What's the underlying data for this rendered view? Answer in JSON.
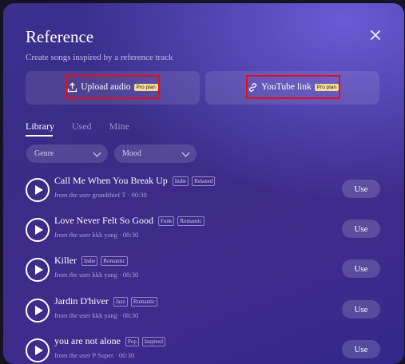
{
  "dialog": {
    "title": "Reference",
    "subtitle": "Create songs inspired by a reference track"
  },
  "sources": {
    "upload": {
      "label": "Upload audio",
      "badge": "Pro plan",
      "icon": "upload-icon"
    },
    "youtube": {
      "label": "YouTube link",
      "badge": "Pro plan",
      "icon": "link-icon"
    }
  },
  "tabs": [
    "Library",
    "Used",
    "Mine"
  ],
  "filters": {
    "genre": "Genre",
    "mood": "Mood"
  },
  "songs": [
    {
      "title": "Call Me When You Break Up",
      "tags": [
        "Indie",
        "Relaxed"
      ],
      "meta": "from the user grandthief T · 00:30",
      "use": "Use"
    },
    {
      "title": "Love Never Felt So Good",
      "tags": [
        "Funk",
        "Romantic"
      ],
      "meta": "from the user kkk yang · 00:30",
      "use": "Use"
    },
    {
      "title": "Killer",
      "tags": [
        "Indie",
        "Romantic"
      ],
      "meta": "from the user kkk yang · 00:30",
      "use": "Use"
    },
    {
      "title": "Jardin D'hiver",
      "tags": [
        "Jazz",
        "Romantic"
      ],
      "meta": "from the user kkk yang · 00:30",
      "use": "Use"
    },
    {
      "title": "you are not alone",
      "tags": [
        "Pop",
        "Inspired"
      ],
      "meta": "from the user P Super · 00:30",
      "use": "Use"
    }
  ],
  "colors": {
    "highlight_box": "#e0101b",
    "badge_bg": "#f3dc9a",
    "dialog_bg": "#3c2f8f"
  }
}
